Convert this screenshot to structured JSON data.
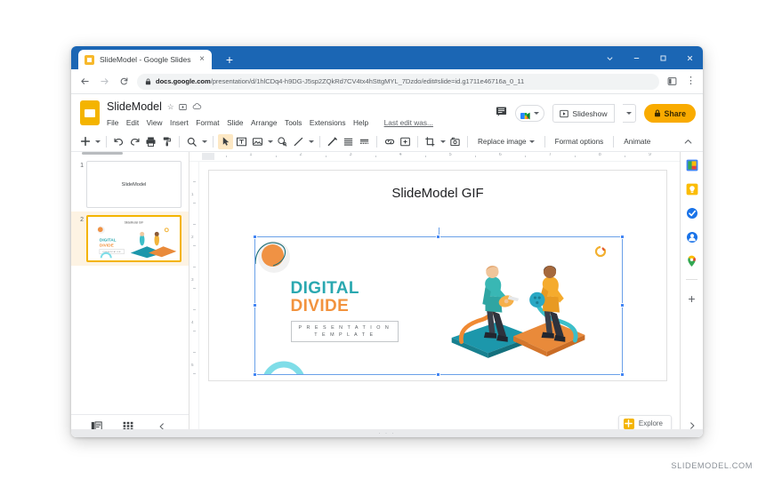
{
  "browser": {
    "tab": {
      "title": "SlideModel - Google Slides",
      "favicon": "slides-favicon",
      "close_label": "×"
    },
    "new_tab_label": "+",
    "window_controls": {
      "collapse": "chevron-down-icon",
      "minimize": "minimize-icon",
      "maximize": "maximize-icon",
      "close": "close-icon"
    },
    "nav": {
      "back": "←",
      "forward": "→",
      "reload": "↻"
    },
    "omnibox": {
      "lock": "lock-icon",
      "domain": "docs.google.com",
      "path": "/presentation/d/1hlCDq4-h9DG-J5sp2ZQkRd7CV4tx4hSttgMYL_7Dzdo/edit#slide=id.g1711e46716a_0_11",
      "full_url": "docs.google.com/presentation/d/1hlCDq4-h9DG-J5sp2ZQkRd7CV4tx4hSttgMYL_7Dzdo/edit#slide=id.g1711e46716a_0_11"
    },
    "toolbar_right": {
      "sidepanel": "side-panel-icon",
      "menu": "⋮"
    }
  },
  "app": {
    "logo": "google-slides-logo",
    "doc_title": "SlideModel",
    "title_icons": [
      {
        "name": "star-icon",
        "glyph": "☆"
      },
      {
        "name": "move-to-folder-icon",
        "glyph": "⧉"
      },
      {
        "name": "cloud-saved-icon",
        "glyph": "☁"
      }
    ],
    "menus": [
      "File",
      "Edit",
      "View",
      "Insert",
      "Format",
      "Slide",
      "Arrange",
      "Tools",
      "Extensions",
      "Help"
    ],
    "last_edit": "Last edit was...",
    "header_right": {
      "comment_icon": "comment-history-icon",
      "meet_icon": "google-meet-icon",
      "slideshow_label": "Slideshow",
      "slideshow_icon": "present-icon",
      "share_label": "Share",
      "share_lock_icon": "lock-icon"
    },
    "toolbar": {
      "icons": [
        {
          "name": "new-slide-icon",
          "glyph": "+"
        },
        {
          "name": "undo-icon",
          "glyph": "↶"
        },
        {
          "name": "redo-icon",
          "glyph": "↷"
        },
        {
          "name": "print-icon",
          "glyph": "⎙"
        },
        {
          "name": "paint-format-icon",
          "glyph": "✐"
        },
        {
          "name": "zoom-icon",
          "glyph": "⌕"
        },
        {
          "name": "select-icon",
          "glyph": "➤",
          "selected": true
        },
        {
          "name": "text-box-icon",
          "glyph": "▣"
        },
        {
          "name": "insert-image-icon",
          "glyph": "▧"
        },
        {
          "name": "shape-icon",
          "glyph": "◯"
        },
        {
          "name": "line-icon",
          "glyph": "╲"
        },
        {
          "name": "curve-icon",
          "glyph": "╱"
        },
        {
          "name": "align-icon",
          "glyph": "≡"
        },
        {
          "name": "line-spacing-icon",
          "glyph": "≣"
        },
        {
          "name": "insert-link-icon",
          "glyph": "∞"
        },
        {
          "name": "insert-comment-icon",
          "glyph": "⊞"
        },
        {
          "name": "crop-icon",
          "glyph": "⇲"
        },
        {
          "name": "mask-image-icon",
          "glyph": "❑"
        }
      ],
      "replace_image_label": "Replace image",
      "format_options_label": "Format options",
      "animate_label": "Animate",
      "collapse_icon": "chevron-up-icon"
    },
    "filmstrip": {
      "slides": [
        {
          "number": "1",
          "title": "SlideModel",
          "active": false
        },
        {
          "number": "2",
          "title": "SlideModel GIF",
          "active": true
        }
      ],
      "bottom": {
        "filmstrip_view_icon": "filmstrip-view-icon",
        "grid_view_icon": "grid-view-icon",
        "collapse_icon": "chevron-left-icon"
      }
    },
    "ruler": {
      "horizontal_ticks": [
        "1",
        "2",
        "3",
        "4",
        "5",
        "6",
        "7",
        "8",
        "9"
      ],
      "vertical_ticks": [
        "1",
        "2",
        "3",
        "4",
        "5"
      ]
    },
    "slide": {
      "title": "SlideModel GIF",
      "heading_line1": "DIGITAL",
      "heading_line2": "DIVIDE",
      "subtitle_line1": "P R E S E N T A T I O N",
      "subtitle_line2": "T E M P L A T E",
      "colors": {
        "teal": "#2aa8b0",
        "orange": "#f2933f",
        "light_teal": "#7fdde8",
        "deep_teal": "#1c97ab",
        "deep_orange": "#e98a3a"
      },
      "selection": "image-selected"
    },
    "explore": {
      "label": "Explore",
      "icon": "explore-icon"
    },
    "right_sidebar": [
      {
        "name": "google-calendar-icon"
      },
      {
        "name": "google-keep-icon"
      },
      {
        "name": "google-tasks-icon"
      },
      {
        "name": "google-contacts-icon"
      },
      {
        "name": "google-maps-icon"
      },
      {
        "name": "add-addon-icon",
        "glyph": "+"
      }
    ],
    "right_sidebar_expand": "chevron-right-icon",
    "statusbar_dots": "· · ·"
  },
  "watermark": "SLIDEMODEL.COM"
}
